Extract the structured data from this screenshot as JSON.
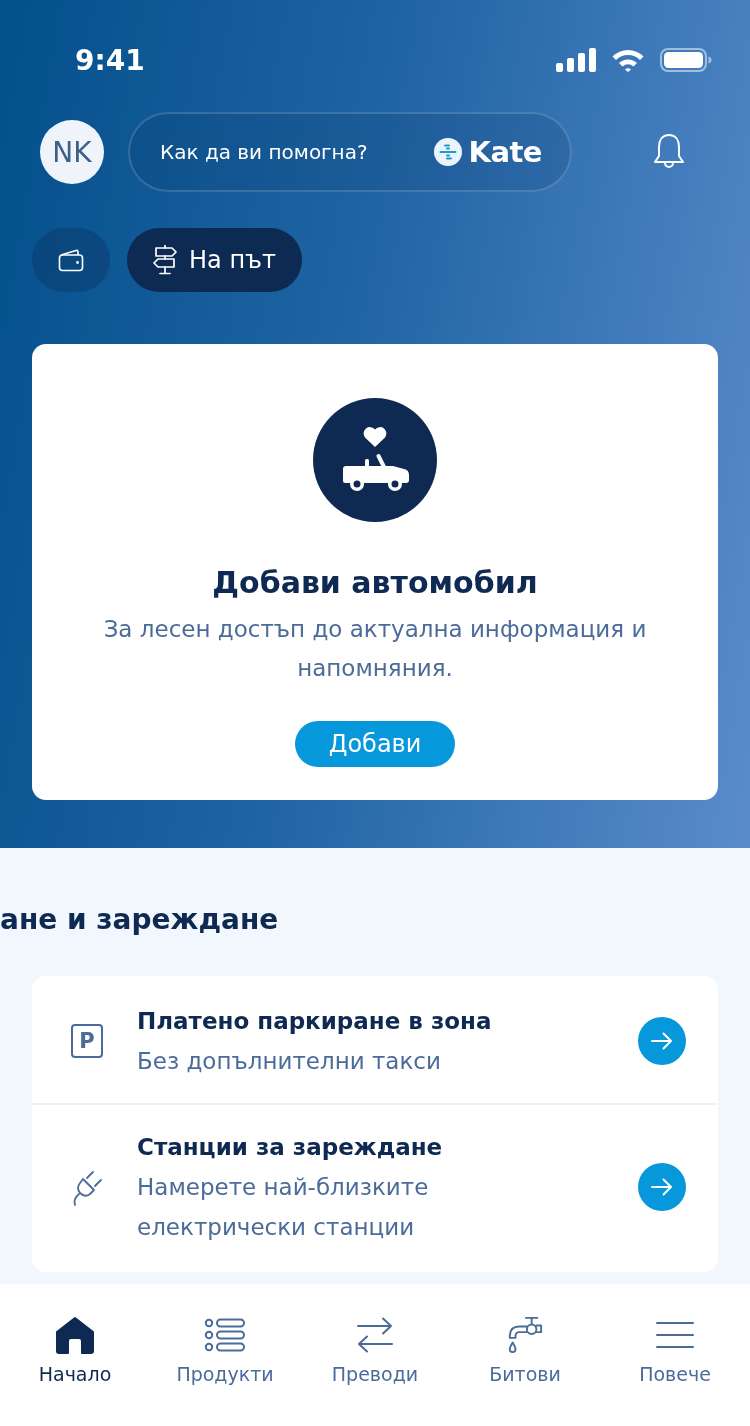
{
  "status_bar": {
    "time": "9:41"
  },
  "header": {
    "avatar": {
      "initials": "NK"
    },
    "search": {
      "placeholder": "Как да ви помогна?",
      "assistant_name": "Kate"
    }
  },
  "chips": [
    {
      "selected": false
    },
    {
      "label": "На път",
      "selected": true
    }
  ],
  "add_car_card": {
    "title": "Добави автомобил",
    "description": "За лесен достъп до актуална информация и напомняния.",
    "button": "Добави"
  },
  "section": {
    "title": "ане и зареждане",
    "items": [
      {
        "sign": "P",
        "title": "Платено паркиране в зона",
        "subtitle": "Без допълнителни такси"
      },
      {
        "title": "Станции за зареждане",
        "subtitle": "Намерете най-близките електрически станции"
      }
    ]
  },
  "bottom_nav": [
    {
      "label": "Начало",
      "selected": true
    },
    {
      "label": "Продукти",
      "selected": false
    },
    {
      "label": "Преводи",
      "selected": false
    },
    {
      "label": "Битови",
      "selected": false
    },
    {
      "label": "Повече",
      "selected": false
    }
  ]
}
